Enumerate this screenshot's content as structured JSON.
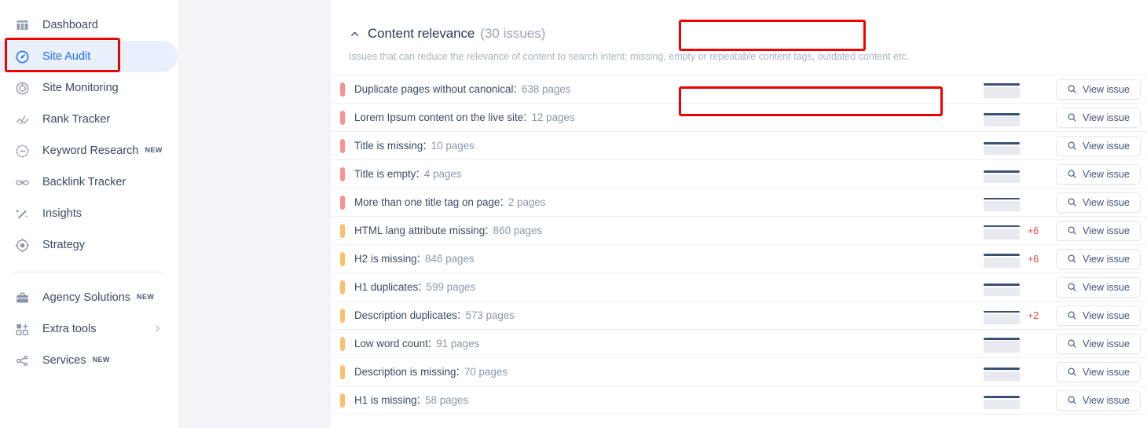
{
  "sidebar": {
    "primary_items": [
      {
        "label": "Dashboard",
        "icon": "dashboard-grid-icon",
        "active": false,
        "badge": ""
      },
      {
        "label": "Site Audit",
        "icon": "gauge-icon",
        "active": true,
        "badge": ""
      },
      {
        "label": "Site Monitoring",
        "icon": "radar-icon",
        "active": false,
        "badge": ""
      },
      {
        "label": "Rank Tracker",
        "icon": "line-chart-icon",
        "active": false,
        "badge": ""
      },
      {
        "label": "Keyword Research",
        "icon": "keyword-circle-icon",
        "active": false,
        "badge": "NEW"
      },
      {
        "label": "Backlink Tracker",
        "icon": "link-chain-icon",
        "active": false,
        "badge": ""
      },
      {
        "label": "Insights",
        "icon": "magic-wand-icon",
        "active": false,
        "badge": ""
      },
      {
        "label": "Strategy",
        "icon": "target-crosshair-icon",
        "active": false,
        "badge": ""
      }
    ],
    "secondary_items": [
      {
        "label": "Agency Solutions",
        "icon": "briefcase-icon",
        "badge": "NEW",
        "chevron": false
      },
      {
        "label": "Extra tools",
        "icon": "grid-plus-icon",
        "badge": "",
        "chevron": true
      },
      {
        "label": "Services",
        "icon": "share-network-icon",
        "badge": "NEW",
        "chevron": false
      }
    ]
  },
  "section": {
    "collapse_icon": "chevron-up-icon",
    "title": "Content relevance",
    "count_label": "(30 issues)",
    "description": "Issues that can reduce the relevance of content to search intent: missing, empty or repeatable content tags, outdated content etc."
  },
  "table": {
    "view_button_label": "View issue",
    "search_icon": "magnifier-icon",
    "count_unit": "pages",
    "rows": [
      {
        "name": "Duplicate pages without canonical",
        "count": "638 pages",
        "severity": "high",
        "delta": "",
        "spark_line_pct": 18,
        "spark_area_pct": 62
      },
      {
        "name": "Lorem Ipsum content on the live site",
        "count": "12 pages",
        "severity": "high",
        "delta": "",
        "spark_line_pct": 26,
        "spark_area_pct": 55
      },
      {
        "name": "Title is missing",
        "count": "10 pages",
        "severity": "high",
        "delta": "",
        "spark_line_pct": 30,
        "spark_area_pct": 50
      },
      {
        "name": "Title is empty",
        "count": "4 pages",
        "severity": "high",
        "delta": "",
        "spark_line_pct": 30,
        "spark_area_pct": 50
      },
      {
        "name": "More than one title tag on page",
        "count": "2 pages",
        "severity": "high",
        "delta": "",
        "spark_line_pct": 24,
        "spark_area_pct": 56
      },
      {
        "name": "HTML lang attribute missing",
        "count": "860 pages",
        "severity": "mid",
        "delta": "+6",
        "spark_line_pct": 20,
        "spark_area_pct": 60
      },
      {
        "name": "H2 is missing",
        "count": "846 pages",
        "severity": "mid",
        "delta": "+6",
        "spark_line_pct": 22,
        "spark_area_pct": 58
      },
      {
        "name": "H1 duplicates",
        "count": "599 pages",
        "severity": "mid",
        "delta": "",
        "spark_line_pct": 30,
        "spark_area_pct": 50
      },
      {
        "name": "Description duplicates",
        "count": "573 pages",
        "severity": "mid",
        "delta": "+2",
        "spark_line_pct": 24,
        "spark_area_pct": 56
      },
      {
        "name": "Low word count",
        "count": "91 pages",
        "severity": "mid",
        "delta": "",
        "spark_line_pct": 16,
        "spark_area_pct": 64
      },
      {
        "name": "Description is missing",
        "count": "70 pages",
        "severity": "mid",
        "delta": "",
        "spark_line_pct": 26,
        "spark_area_pct": 54
      },
      {
        "name": "H1 is missing",
        "count": "58 pages",
        "severity": "mid",
        "delta": "",
        "spark_line_pct": 26,
        "spark_area_pct": 54
      }
    ]
  },
  "annotations": {
    "site_audit_highlight": "red-box-site-audit",
    "section_highlight": "red-box-content-relevance",
    "first_issue_highlight": "red-box-duplicate-pages"
  },
  "colors": {
    "accent_blue": "#1f6feb",
    "active_pill": "#e9effb",
    "severity_high": "#fa9090",
    "severity_mid": "#fbbf6e",
    "delta_red": "#ef4444",
    "annotation_red": "#ec0000",
    "sparkline_navy": "#3c5075"
  }
}
